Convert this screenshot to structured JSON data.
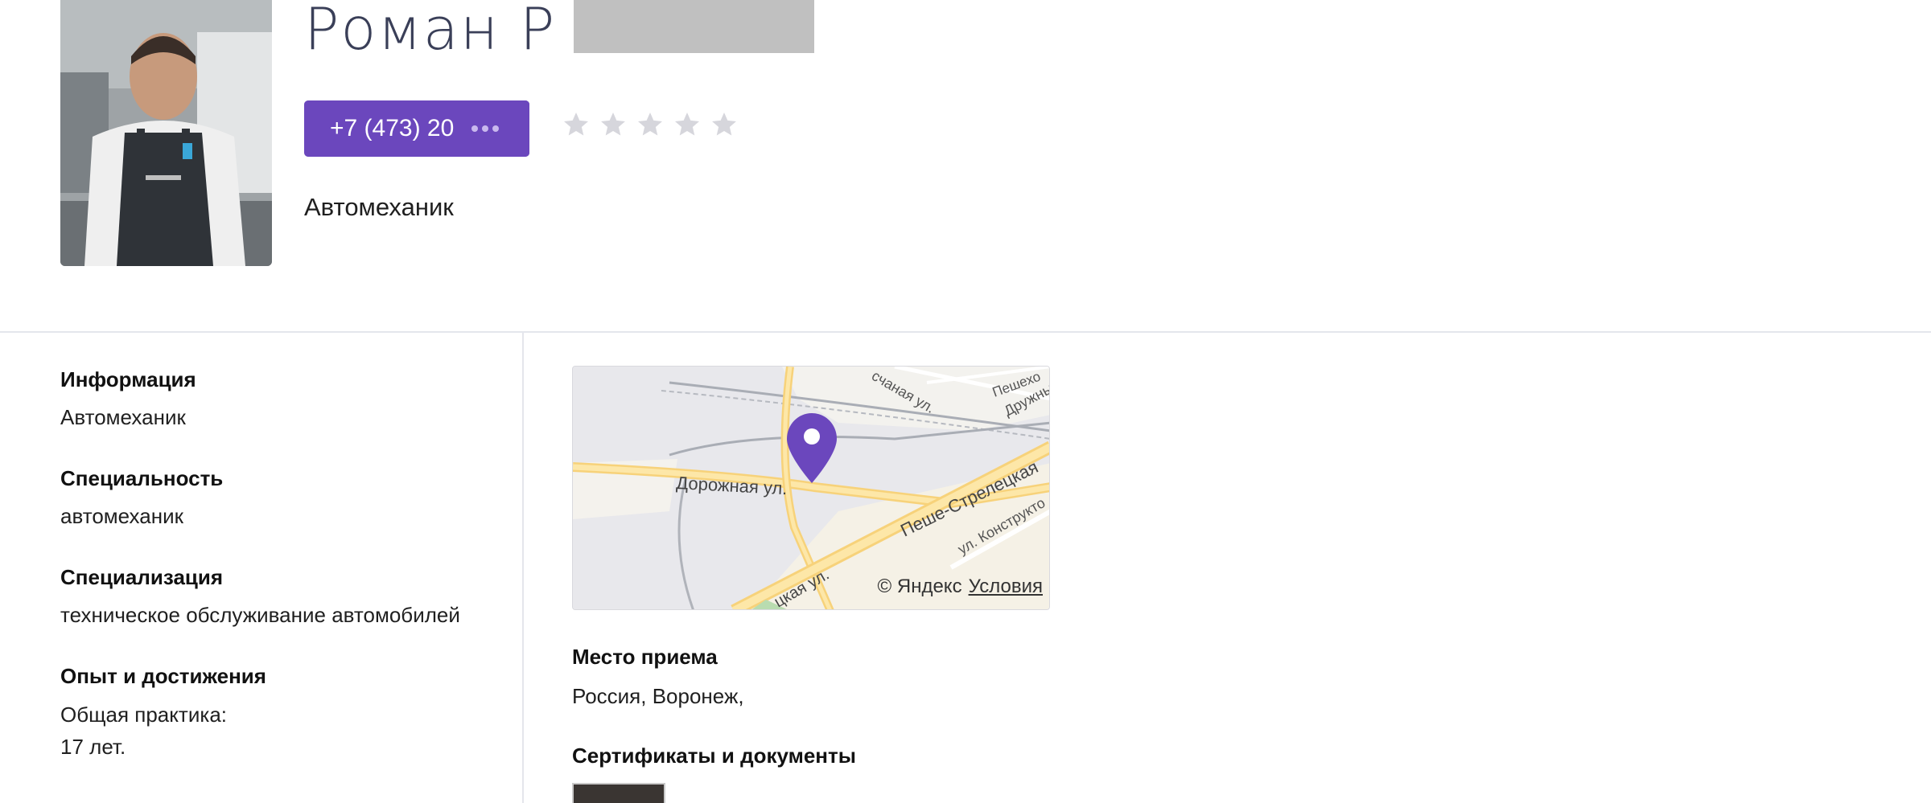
{
  "profile": {
    "name_visible": "Роман  Р",
    "phone": "+7 (473) 20",
    "rating": {
      "value": 0,
      "max": 5
    },
    "profession": "Автомеханик"
  },
  "info": {
    "information": {
      "label": "Информация",
      "value": "Автомеханик"
    },
    "specialty": {
      "label": "Специальность",
      "value": "автомеханик"
    },
    "specialization": {
      "label": "Специализация",
      "value": "техническое обслуживание автомобилей"
    },
    "experience": {
      "label": "Опыт и достижения",
      "line1": "Общая практика:",
      "line2": "17 лет."
    }
  },
  "map": {
    "streets": {
      "dorozhnaya": "Дорожная ул.",
      "peshe": "Пеше-Стрелецкая",
      "konstrukt": "ул. Конструкто",
      "pesch": "счаная ул.",
      "peshekh": "Пешехо",
      "druzh": "Дружны",
      "kaya": "цкая ул."
    },
    "copyright": "© Яндекс",
    "terms": "Условия",
    "pin_color": "#6b47bd"
  },
  "reception": {
    "label": "Место приема",
    "value": "Россия, Воронеж,"
  },
  "certificates": {
    "label": "Сертификаты и документы"
  },
  "colors": {
    "accent": "#6b47bd",
    "name": "#3a3f58",
    "star": "#d6d6dc",
    "divider": "#e4e6ec"
  }
}
